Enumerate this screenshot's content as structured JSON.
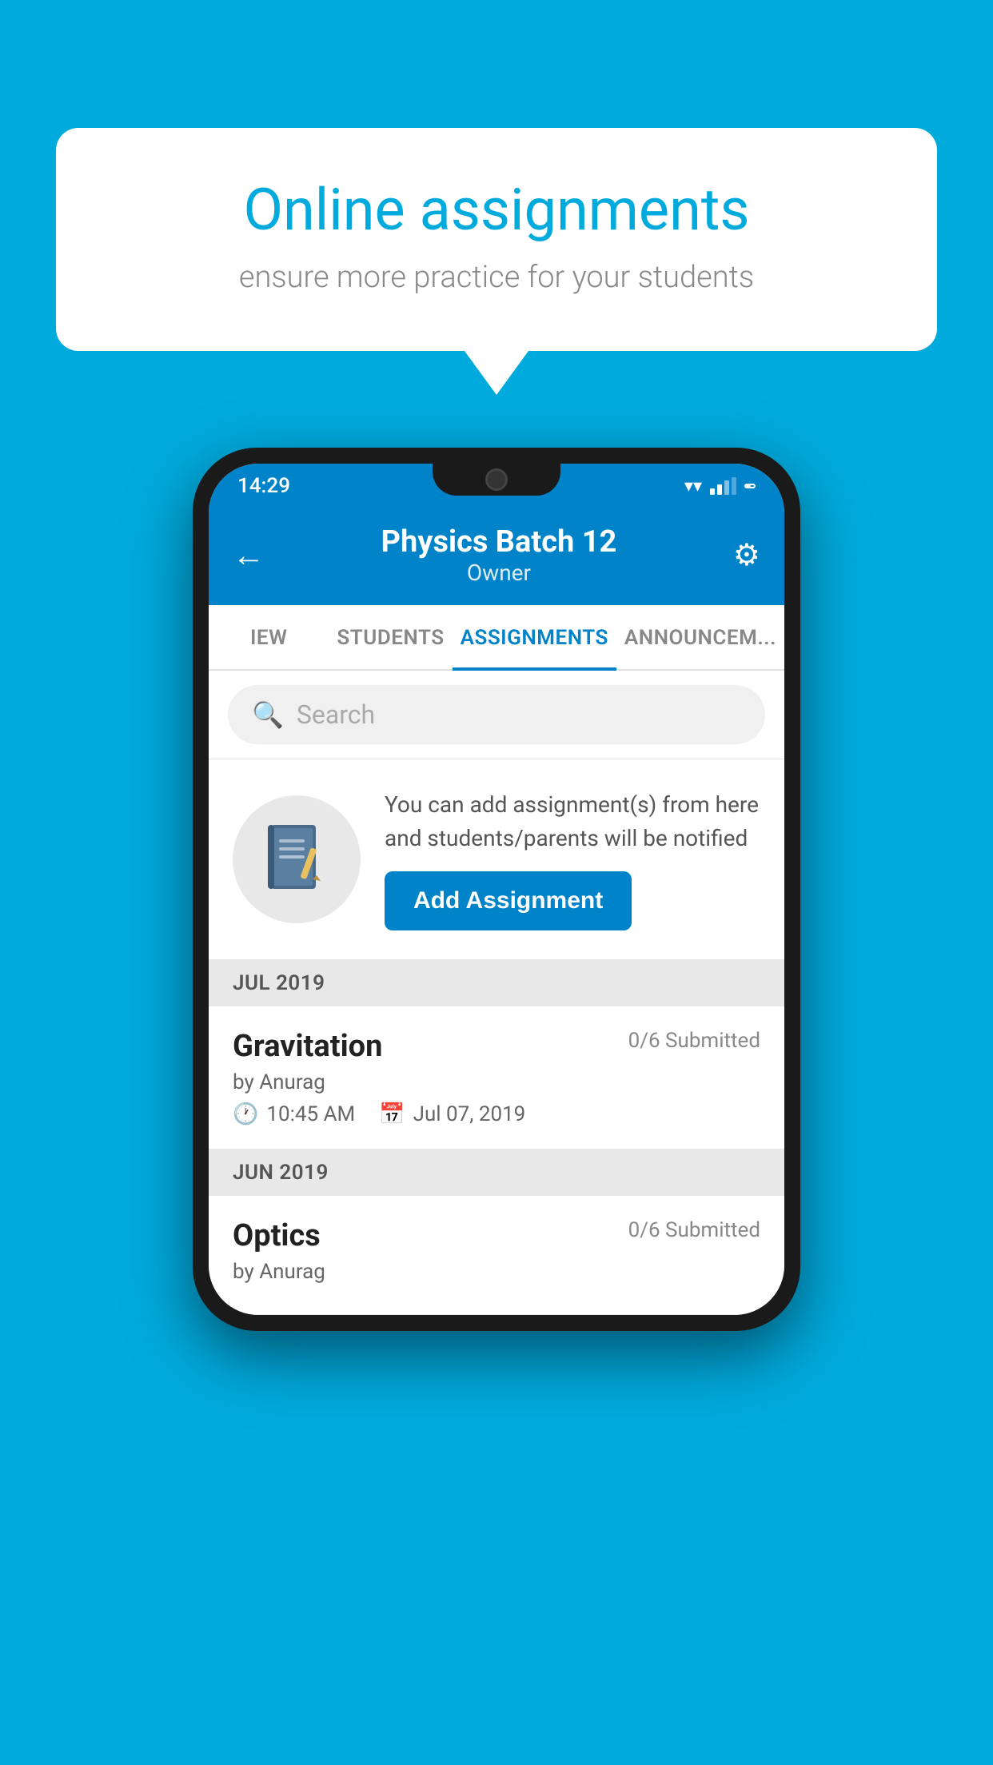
{
  "background_color": "#00AADD",
  "speech_bubble": {
    "title": "Online assignments",
    "subtitle": "ensure more practice for your students"
  },
  "status_bar": {
    "time": "14:29"
  },
  "header": {
    "title": "Physics Batch 12",
    "subtitle": "Owner"
  },
  "tabs": [
    {
      "label": "IEW",
      "active": false
    },
    {
      "label": "STUDENTS",
      "active": false
    },
    {
      "label": "ASSIGNMENTS",
      "active": true
    },
    {
      "label": "ANNOUNCEM...",
      "active": false
    }
  ],
  "search": {
    "placeholder": "Search"
  },
  "promo": {
    "description": "You can add assignment(s) from here and students/parents will be notified",
    "button_label": "Add Assignment"
  },
  "sections": [
    {
      "label": "JUL 2019",
      "assignments": [
        {
          "name": "Gravitation",
          "submitted": "0/6 Submitted",
          "by": "by Anurag",
          "time": "10:45 AM",
          "date": "Jul 07, 2019"
        }
      ]
    },
    {
      "label": "JUN 2019",
      "assignments": [
        {
          "name": "Optics",
          "submitted": "0/6 Submitted",
          "by": "by Anurag",
          "time": "",
          "date": ""
        }
      ]
    }
  ]
}
